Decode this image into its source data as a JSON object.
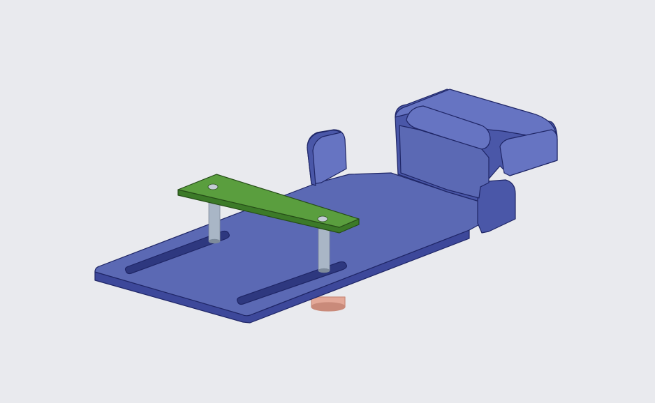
{
  "scene": {
    "background": "#e9eaee",
    "colors": {
      "plate_top": "#5b69b4",
      "plate_edge": "#3d489a",
      "plate_dark": "#2e387f",
      "clamp_top": "#6674c2",
      "clamp_side": "#4a57a8",
      "pcb_top": "#5a9e3e",
      "pcb_edge": "#3c7a28",
      "standoff": "#a9b6c6",
      "standoff_dark": "#7e8b9b",
      "pin": "#e3a898",
      "pin_dark": "#c98a7a",
      "outline": "#1f2666"
    },
    "parts": [
      {
        "name": "base-plate",
        "color": "plate_top"
      },
      {
        "name": "slot-left",
        "color": "plate_dark"
      },
      {
        "name": "slot-right",
        "color": "plate_dark"
      },
      {
        "name": "clamp-block",
        "color": "clamp_top"
      },
      {
        "name": "roller",
        "color": "clamp_top"
      },
      {
        "name": "side-tab",
        "color": "clamp_side"
      },
      {
        "name": "pcb-board",
        "color": "pcb_top"
      },
      {
        "name": "standoff-left",
        "color": "standoff"
      },
      {
        "name": "standoff-right",
        "color": "standoff"
      },
      {
        "name": "pin-bottom",
        "color": "pin"
      }
    ]
  }
}
